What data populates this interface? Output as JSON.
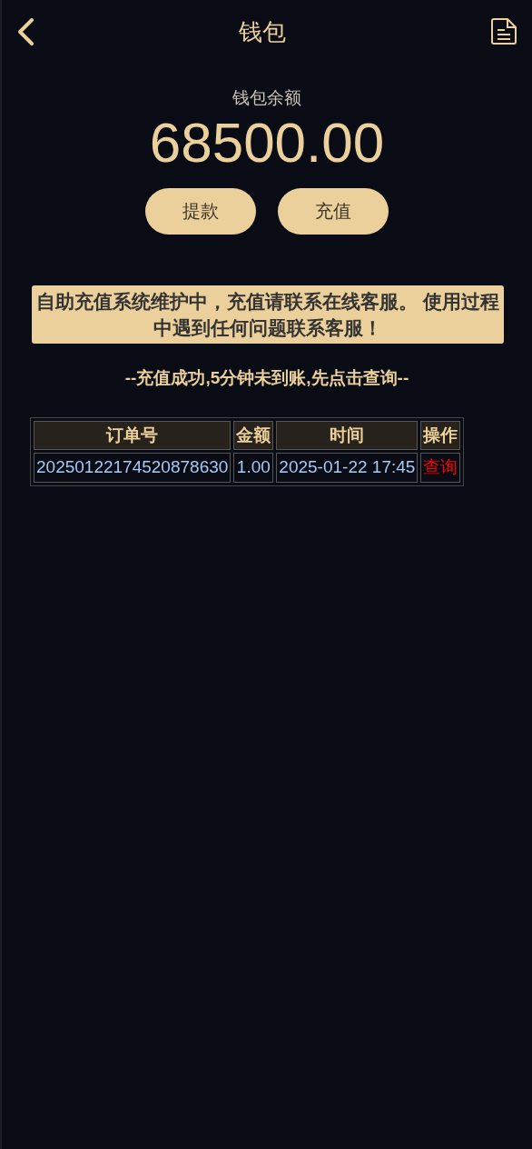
{
  "header": {
    "title": "钱包"
  },
  "balance": {
    "label": "钱包余额",
    "amount": "68500.00"
  },
  "buttons": [
    "提款",
    "充值"
  ],
  "notice": "自助充值系统维护中，充值请联系在线客服。 使用过程中遇到任何问题联系客服！",
  "hint": "--充值成功,5分钟未到账,先点击查询--",
  "table": {
    "columns": [
      "订单号",
      "金额",
      "时间",
      "操作"
    ],
    "rows": [
      {
        "order_no": "20250122174520878630",
        "amount": "1.00",
        "time": "2025-01-22 17:45",
        "action": "查询"
      }
    ]
  }
}
